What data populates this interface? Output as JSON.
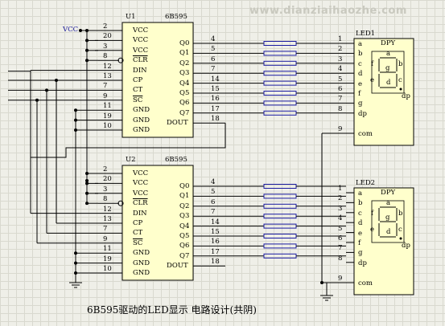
{
  "watermark": "www.dianziaihaozhe.com",
  "caption": "6B595驱动的LED显示 电路设计(共阴)",
  "chips": [
    {
      "ref": "U1",
      "part": "6B595",
      "left_pins": [
        {
          "num": "2",
          "name": "VCC"
        },
        {
          "num": "20",
          "name": "VCC"
        },
        {
          "num": "3",
          "name": "VCC"
        },
        {
          "num": "8",
          "name": "CLR"
        },
        {
          "num": "12",
          "name": "DIN"
        },
        {
          "num": "13",
          "name": "CP"
        },
        {
          "num": "7",
          "name": "CT"
        },
        {
          "num": "9",
          "name": "SC"
        },
        {
          "num": "11",
          "name": "GND"
        },
        {
          "num": "19",
          "name": "GND"
        },
        {
          "num": "10",
          "name": "GND"
        }
      ],
      "right_pins": [
        {
          "num": "4",
          "name": "Q0"
        },
        {
          "num": "5",
          "name": "Q1"
        },
        {
          "num": "6",
          "name": "Q2"
        },
        {
          "num": "7",
          "name": "Q3"
        },
        {
          "num": "14",
          "name": "Q4"
        },
        {
          "num": "15",
          "name": "Q5"
        },
        {
          "num": "16",
          "name": "Q6"
        },
        {
          "num": "17",
          "name": "Q7"
        },
        {
          "num": "18",
          "name": "DOUT"
        }
      ]
    },
    {
      "ref": "U2",
      "part": "6B595",
      "left_pins": [
        {
          "num": "2",
          "name": "VCC"
        },
        {
          "num": "20",
          "name": "VCC"
        },
        {
          "num": "3",
          "name": "VCC"
        },
        {
          "num": "8",
          "name": "CLR"
        },
        {
          "num": "12",
          "name": "DIN"
        },
        {
          "num": "13",
          "name": "CP"
        },
        {
          "num": "7",
          "name": "CT"
        },
        {
          "num": "9",
          "name": "SC"
        },
        {
          "num": "11",
          "name": "GND"
        },
        {
          "num": "19",
          "name": "GND"
        },
        {
          "num": "10",
          "name": "GND"
        }
      ],
      "right_pins": [
        {
          "num": "4",
          "name": "Q0"
        },
        {
          "num": "5",
          "name": "Q1"
        },
        {
          "num": "6",
          "name": "Q2"
        },
        {
          "num": "7",
          "name": "Q3"
        },
        {
          "num": "14",
          "name": "Q4"
        },
        {
          "num": "15",
          "name": "Q5"
        },
        {
          "num": "16",
          "name": "Q6"
        },
        {
          "num": "17",
          "name": "Q7"
        },
        {
          "num": "18",
          "name": "DOUT"
        }
      ]
    }
  ],
  "displays": [
    {
      "ref": "LED1",
      "part": "DPY",
      "pins": [
        {
          "num": "1",
          "name": "a"
        },
        {
          "num": "2",
          "name": "b"
        },
        {
          "num": "3",
          "name": "c"
        },
        {
          "num": "4",
          "name": "d"
        },
        {
          "num": "5",
          "name": "e"
        },
        {
          "num": "6",
          "name": "f"
        },
        {
          "num": "7",
          "name": "g"
        },
        {
          "num": "8",
          "name": "dp"
        },
        {
          "num": "9",
          "name": "com"
        }
      ],
      "segments": [
        "a",
        "b",
        "c",
        "d",
        "e",
        "f",
        "g",
        "dp"
      ]
    },
    {
      "ref": "LED2",
      "part": "DPY",
      "pins": [
        {
          "num": "1",
          "name": "a"
        },
        {
          "num": "2",
          "name": "b"
        },
        {
          "num": "3",
          "name": "c"
        },
        {
          "num": "4",
          "name": "d"
        },
        {
          "num": "5",
          "name": "e"
        },
        {
          "num": "6",
          "name": "f"
        },
        {
          "num": "7",
          "name": "g"
        },
        {
          "num": "8",
          "name": "dp"
        },
        {
          "num": "9",
          "name": "com"
        }
      ],
      "segments": [
        "a",
        "b",
        "c",
        "d",
        "e",
        "f",
        "g",
        "dp"
      ]
    }
  ],
  "vcc_label": "VCC",
  "colors": {
    "wire": "#000000",
    "resistor": "#1a1aa0",
    "chip_fill": "#ffffcc",
    "background": "#efefe8",
    "grid": "#d9d9cf"
  }
}
